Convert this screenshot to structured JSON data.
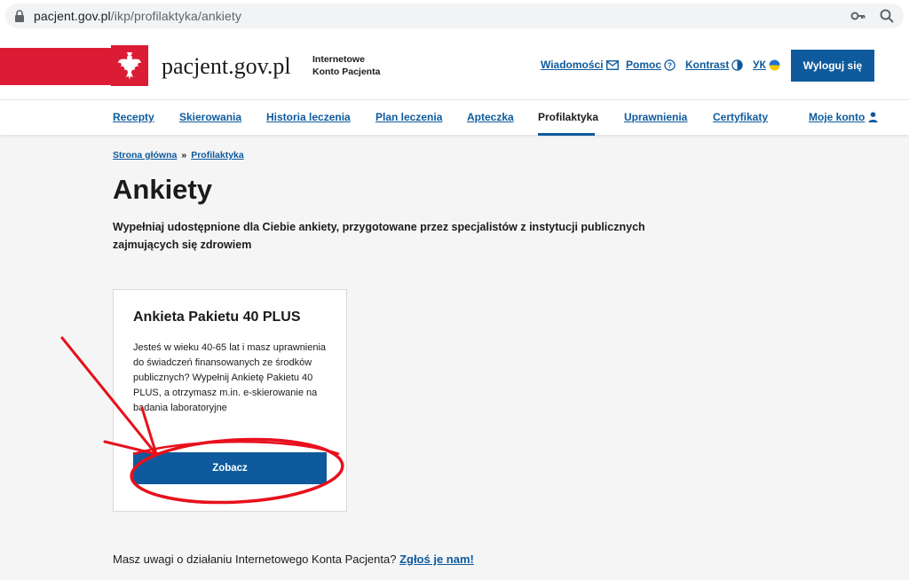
{
  "browser": {
    "url_domain": "pacjent.gov.pl",
    "url_path": "/ikp/profilaktyka/ankiety"
  },
  "header": {
    "logo": "pacjent.gov.pl",
    "ikp_line1": "Internetowe",
    "ikp_line2": "Konto Pacjenta",
    "links": {
      "messages": "Wiadomości",
      "help": "Pomoc",
      "contrast": "Kontrast",
      "language": "УК"
    },
    "logout": "Wyloguj się"
  },
  "nav": {
    "items": [
      {
        "label": "Recepty"
      },
      {
        "label": "Skierowania"
      },
      {
        "label": "Historia leczenia"
      },
      {
        "label": "Plan leczenia"
      },
      {
        "label": "Apteczka"
      },
      {
        "label": "Profilaktyka"
      },
      {
        "label": "Uprawnienia"
      },
      {
        "label": "Certyfikaty"
      },
      {
        "label": "Moje konto"
      }
    ],
    "active": "Profilaktyka"
  },
  "breadcrumb": {
    "home": "Strona główna",
    "separator": "»",
    "current": "Profilaktyka"
  },
  "page": {
    "title": "Ankiety",
    "lead": "Wypełniaj udostępnione dla Ciebie ankiety, przygotowane przez specjalistów z instytucji publicznych zajmujących się zdrowiem"
  },
  "card": {
    "title": "Ankieta Pakietu 40 PLUS",
    "description": "Jesteś w wieku 40-65 lat i masz uprawnienia do świadczeń finansowanych ze środków publicznych? Wypełnij Ankietę Pakietu 40 PLUS, a otrzymasz m.in. e-skierowanie na badania laboratoryjne",
    "button": "Zobacz"
  },
  "feedback": {
    "text": "Masz uwagi o działaniu Internetowego Konta Pacjenta?",
    "link": "Zgłoś je nam!"
  },
  "colors": {
    "brand_blue": "#0e5a9c",
    "brand_red": "#dc1c35",
    "annotation_red": "#e8101c"
  }
}
